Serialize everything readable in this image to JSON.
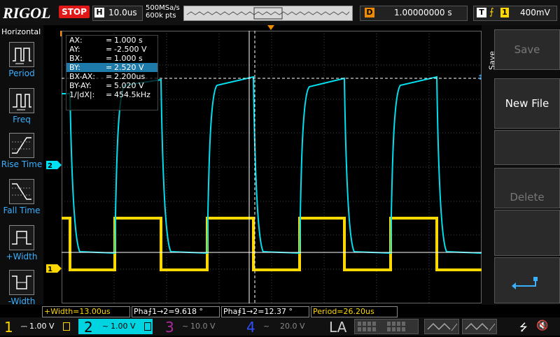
{
  "brand": "RIGOL",
  "run_state": "STOP",
  "horizontal": {
    "letter": "H",
    "scale": "10.0us"
  },
  "acquisition": {
    "sample_rate": "500MSa/s",
    "memory": "600k pts"
  },
  "delay": {
    "letter": "D",
    "value": "1.00000000 s"
  },
  "trigger": {
    "letter": "T",
    "edge_symbol": "⨍",
    "source": "1",
    "level": "400mV"
  },
  "left_menu": {
    "title": "Horizontal",
    "items": [
      {
        "label": "Period"
      },
      {
        "label": "Freq"
      },
      {
        "label": "Rise Time"
      },
      {
        "label": "Fall Time"
      },
      {
        "label": "+Width"
      },
      {
        "label": "-Width"
      }
    ]
  },
  "cursor_table": [
    {
      "key": "AX:",
      "value": "1.000 s"
    },
    {
      "key": "AY:",
      "value": "-2.500 V"
    },
    {
      "key": "BX:",
      "value": "1.000 s"
    },
    {
      "key": "BY:",
      "value": "2.520 V"
    },
    {
      "key": "BX-AX:",
      "value": "2.200us"
    },
    {
      "key": "BY-AY:",
      "value": "5.020 V"
    },
    {
      "key": "1/|dX|:",
      "value": "454.5kHz"
    }
  ],
  "channel_markers": {
    "ch1": "1",
    "ch2": "2",
    "trig": "T"
  },
  "right_panel": {
    "tab": "Save",
    "buttons": [
      {
        "label": "Save"
      },
      {
        "label": "New File"
      },
      {
        "label": "Delete"
      }
    ]
  },
  "measurements": [
    {
      "label": "+Width=13.00us"
    },
    {
      "label": "Pha⨍1→2=9.618 °"
    },
    {
      "label": "Pha⨎1→2=12.37 °"
    },
    {
      "label": "Period=26.20us"
    }
  ],
  "channels": [
    {
      "num": "1",
      "coupling": "⎓",
      "scale": "1.00 V",
      "color": "#ffd800"
    },
    {
      "num": "2",
      "coupling": "~",
      "scale": "1.00 V",
      "color": "#00e0f0"
    },
    {
      "num": "3",
      "coupling": "~",
      "scale": "10.0 V",
      "color": "#b02aa0"
    },
    {
      "num": "4",
      "coupling": "~",
      "scale": "20.0 V",
      "color": "#3050ff"
    }
  ],
  "la_label": "LA",
  "colors": {
    "ch1": "#ffd800",
    "ch2": "#00e0f0",
    "accent": "#3ab0ff",
    "stop": "#e01818",
    "marker": "#f08a00"
  }
}
